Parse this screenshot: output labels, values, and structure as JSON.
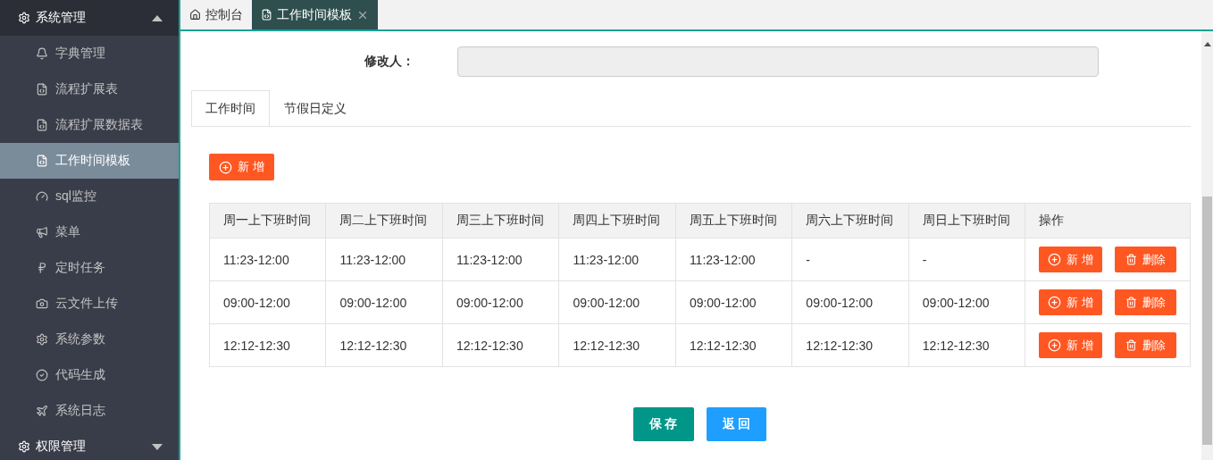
{
  "sidebar": {
    "groups": [
      {
        "label": "系统管理",
        "expanded": true,
        "items": [
          {
            "label": "字典管理",
            "selected": false
          },
          {
            "label": "流程扩展表",
            "selected": false
          },
          {
            "label": "流程扩展数据表",
            "selected": false
          },
          {
            "label": "工作时间模板",
            "selected": true
          },
          {
            "label": "sql监控",
            "selected": false
          },
          {
            "label": "菜单",
            "selected": false
          },
          {
            "label": "定时任务",
            "selected": false
          },
          {
            "label": "云文件上传",
            "selected": false
          },
          {
            "label": "系统参数",
            "selected": false
          },
          {
            "label": "代码生成",
            "selected": false
          },
          {
            "label": "系统日志",
            "selected": false
          }
        ]
      },
      {
        "label": "权限管理",
        "expanded": false
      }
    ]
  },
  "page_tabs": [
    {
      "label": "控制台",
      "selected": false,
      "closable": false
    },
    {
      "label": "工作时间模板",
      "selected": true,
      "closable": true
    }
  ],
  "form": {
    "modifier_label": "修改人：",
    "modifier_disabled": true
  },
  "section_tabs": [
    {
      "label": "工作时间",
      "selected": true
    },
    {
      "label": "节假日定义",
      "selected": false
    }
  ],
  "add_button": "新 增",
  "table": {
    "columns": [
      "周一上下班时间",
      "周二上下班时间",
      "周三上下班时间",
      "周四上下班时间",
      "周五上下班时间",
      "周六上下班时间",
      "周日上下班时间",
      "操作"
    ],
    "rows": [
      {
        "cells": [
          "11:23-12:00",
          "11:23-12:00",
          "11:23-12:00",
          "11:23-12:00",
          "11:23-12:00",
          "-",
          "-"
        ],
        "actions": [
          "新 增",
          "删除"
        ]
      },
      {
        "cells": [
          "09:00-12:00",
          "09:00-12:00",
          "09:00-12:00",
          "09:00-12:00",
          "09:00-12:00",
          "09:00-12:00",
          "09:00-12:00"
        ],
        "actions": [
          "新 增",
          "删除"
        ]
      },
      {
        "cells": [
          "12:12-12:30",
          "12:12-12:30",
          "12:12-12:30",
          "12:12-12:30",
          "12:12-12:30",
          "12:12-12:30",
          "12:12-12:30"
        ],
        "actions": [
          "新 增",
          "删除"
        ]
      }
    ]
  },
  "footer_buttons": [
    {
      "label": "保 存",
      "kind": "save"
    },
    {
      "label": "返 回",
      "kind": "back"
    }
  ]
}
